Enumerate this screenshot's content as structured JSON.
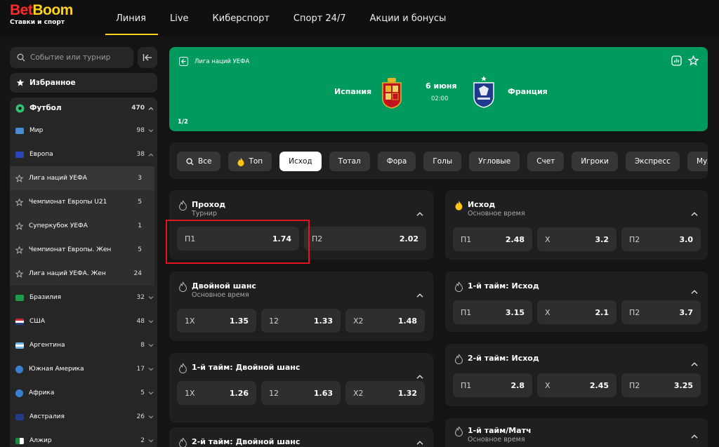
{
  "brand": {
    "part1": "Bet",
    "part2": "Boom",
    "tagline": "Ставки и спорт",
    "color_red": "#ff2a2a",
    "color_yellow": "#ffd21e"
  },
  "nav": [
    {
      "label": "Линия",
      "active": true
    },
    {
      "label": "Live"
    },
    {
      "label": "Киберспорт"
    },
    {
      "label": "Спорт 24/7"
    },
    {
      "label": "Акции и бонусы"
    }
  ],
  "sidebar": {
    "search_placeholder": "Событие или турнир",
    "favorites": "Избранное",
    "sport": {
      "label": "Футбол",
      "count": "470"
    },
    "items": [
      {
        "label": "Мир",
        "count": "98"
      },
      {
        "label": "Европа",
        "count": "38"
      },
      {
        "label": "Лига наций УЕФА",
        "count": "3"
      },
      {
        "label": "Чемпионат Европы U21",
        "count": "5"
      },
      {
        "label": "Суперкубок УЕФА",
        "count": "1"
      },
      {
        "label": "Чемпионат Европы. Жен",
        "count": "5"
      },
      {
        "label": "Лига наций УЕФА. Жен",
        "count": "24"
      },
      {
        "label": "Бразилия",
        "count": "32"
      },
      {
        "label": "США",
        "count": "48"
      },
      {
        "label": "Аргентина",
        "count": "8"
      },
      {
        "label": "Южная Америка",
        "count": "17"
      },
      {
        "label": "Африка",
        "count": "5"
      },
      {
        "label": "Австралия",
        "count": "26"
      },
      {
        "label": "Алжир",
        "count": "2"
      }
    ]
  },
  "banner": {
    "league": "Лига наций УЕФА",
    "team1": "Испания",
    "team2": "Франция",
    "date": "6 июня",
    "time": "02:00",
    "pager": "1/2",
    "bg": "#009a5e"
  },
  "filters": [
    "Все",
    "Топ",
    "Исход",
    "Тотал",
    "Фора",
    "Голы",
    "Угловые",
    "Счет",
    "Игроки",
    "Экспресс",
    "Мультиголы"
  ],
  "markets": {
    "prohod": {
      "title": "Проход",
      "sub": "Турнир",
      "o": [
        {
          "k": "П1",
          "v": "1.74"
        },
        {
          "k": "П2",
          "v": "2.02"
        }
      ]
    },
    "double": {
      "title": "Двойной шанс",
      "sub": "Основное время",
      "o": [
        {
          "k": "1X",
          "v": "1.35"
        },
        {
          "k": "12",
          "v": "1.33"
        },
        {
          "k": "X2",
          "v": "1.48"
        }
      ]
    },
    "h1double": {
      "title": "1-й тайм: Двойной шанс",
      "o": [
        {
          "k": "1X",
          "v": "1.26"
        },
        {
          "k": "12",
          "v": "1.63"
        },
        {
          "k": "X2",
          "v": "1.32"
        }
      ]
    },
    "h2double": {
      "title": "2-й тайм: Двойной шанс"
    },
    "ishod": {
      "title": "Исход",
      "sub": "Основное время",
      "o": [
        {
          "k": "П1",
          "v": "2.48"
        },
        {
          "k": "X",
          "v": "3.2"
        },
        {
          "k": "П2",
          "v": "3.0"
        }
      ]
    },
    "h1ishod": {
      "title": "1-й тайм: Исход",
      "o": [
        {
          "k": "П1",
          "v": "3.15"
        },
        {
          "k": "X",
          "v": "2.1"
        },
        {
          "k": "П2",
          "v": "3.7"
        }
      ]
    },
    "h2ishod": {
      "title": "2-й тайм: Исход",
      "o": [
        {
          "k": "П1",
          "v": "2.8"
        },
        {
          "k": "X",
          "v": "2.45"
        },
        {
          "k": "П2",
          "v": "3.25"
        }
      ]
    },
    "h1match": {
      "title": "1-й тайм/Матч",
      "sub": "Основное время"
    }
  },
  "colors": {
    "highlight": "#e0141e",
    "accent": "#ffd21e"
  }
}
